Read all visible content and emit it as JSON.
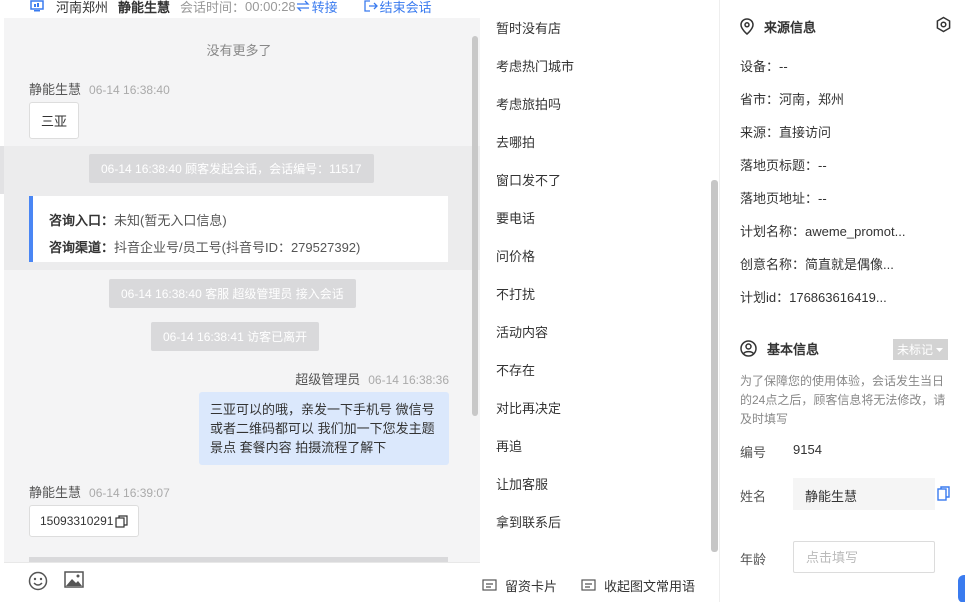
{
  "header": {
    "location": "河南郑州",
    "customer_name": "静能生慧",
    "session_time_label": "会话时间：",
    "session_time": "00:00:28",
    "transfer_label": "转接",
    "end_label": "结束会话"
  },
  "chat": {
    "no_more": "没有更多了",
    "msg1": {
      "sender": "静能生慧",
      "time": "06-14 16:38:40",
      "text": "三亚"
    },
    "sys1": "06-14 16:38:40 顾客发起会话，会话编号：11517",
    "entry": {
      "entry_label": "咨询入口：",
      "entry_value": "未知(暂无入口信息)",
      "channel_label": "咨询渠道：",
      "channel_value": "抖音企业号/员工号(抖音号ID：279527392)"
    },
    "sys2": "06-14 16:38:40 客服 超级管理员 接入会话",
    "sys3": "06-14 16:38:41 访客已离开",
    "msg2": {
      "sender": "超级管理员",
      "time": "06-14 16:38:36",
      "text": "三亚可以的哦，亲发一下手机号 微信号或者二维码都可以 我们加一下您发主题景点 套餐内容 拍摄流程了解下"
    },
    "msg3": {
      "sender": "静能生慧",
      "time": "06-14 16:39:07",
      "text": "15093310291"
    }
  },
  "phrases": {
    "items": [
      "暂时没有店",
      "考虑热门城市",
      "考虑旅拍吗",
      "去哪拍",
      "窗口发不了",
      "要电话",
      "问价格",
      "不打扰",
      "活动内容",
      "不存在",
      "对比再决定",
      "再追",
      "让加客服",
      "拿到联系后"
    ],
    "footer_card": "留资卡片",
    "footer_collapse": "收起图文常用语"
  },
  "info": {
    "source_title": "来源信息",
    "device": "设备：--",
    "province": "省市：河南，郑州",
    "source": "来源：直接访问",
    "landing_title": "落地页标题：--",
    "landing_url": "落地页地址：--",
    "plan_name": "计划名称：aweme_promot...",
    "creative_name": "创意名称：简直就是偶像...",
    "plan_id": "计划id：176863616419...",
    "basic_title": "基本信息",
    "unmarked": "未标记",
    "notice": "为了保障您的使用体验，会话发生当日的24点之后，顾客信息将无法修改，请及时填写",
    "id_label": "编号",
    "id_value": "9154",
    "name_label": "姓名",
    "name_value": "静能生慧",
    "age_label": "年龄",
    "age_placeholder": "点击填写"
  },
  "colors": {
    "accent": "#3a7bef",
    "customer_bubble": "#dbe8fc",
    "entry_border": "#4a86f4"
  }
}
